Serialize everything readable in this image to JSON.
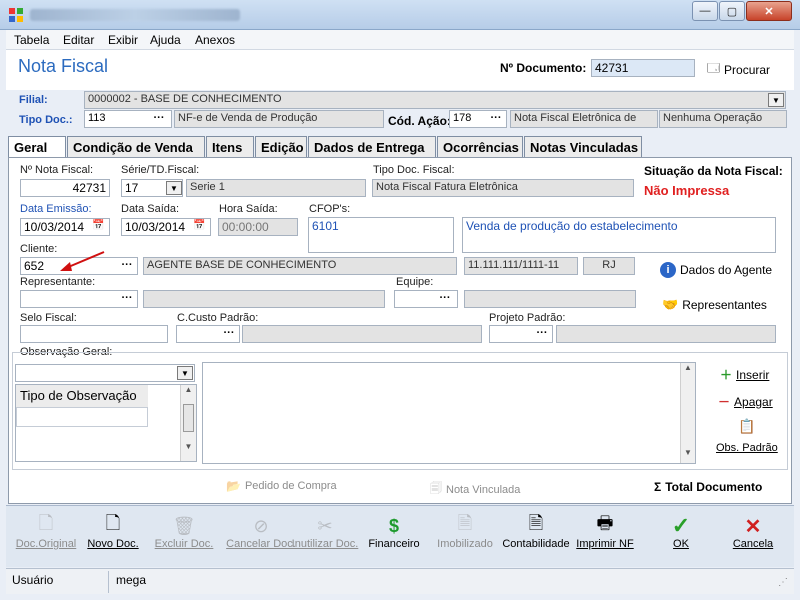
{
  "menu": [
    "Tabela",
    "Editar",
    "Exibir",
    "Ajuda",
    "Anexos"
  ],
  "header": {
    "title": "Nota Fiscal",
    "doc_label": "Nº Documento:",
    "doc_value": "42731",
    "search_label": "Procurar"
  },
  "filial": {
    "label": "Filial:",
    "value": "0000002 - BASE DE CONHECIMENTO"
  },
  "tipo_doc": {
    "label": "Tipo Doc.:",
    "code": "113",
    "desc": "NF-e de Venda de Produção"
  },
  "cod_acao": {
    "label": "Cód. Ação:",
    "code": "178",
    "desc": "Nota Fiscal Eletrônica de",
    "extra": "Nenhuma Operação"
  },
  "tabs": [
    "Geral",
    "Condição de Venda",
    "Itens",
    "Edição",
    "Dados de Entrega",
    "Ocorrências",
    "Notas Vinculadas"
  ],
  "geral": {
    "nf_label": "Nº Nota Fiscal:",
    "nf_value": "42731",
    "serie_label": "Série/TD.Fiscal:",
    "serie_value": "17",
    "serie_desc": "Serie 1",
    "tipo_doc_fiscal_label": "Tipo Doc. Fiscal:",
    "tipo_doc_fiscal_value": "Nota Fiscal Fatura Eletrônica",
    "situacao_label": "Situação da Nota Fiscal:",
    "situacao_value": "Não Impressa",
    "emissao_label": "Data Emissão:",
    "emissao_value": "10/03/2014",
    "saida_label": "Data Saída:",
    "saida_value": "10/03/2014",
    "hora_label": "Hora Saída:",
    "hora_value": "00:00:00",
    "cfop_label": "CFOP's:",
    "cfop_value": "6101",
    "cfop_desc": "Venda de produção do estabelecimento",
    "cliente_label": "Cliente:",
    "cliente_code": "652",
    "cliente_name": "AGENTE BASE DE CONHECIMENTO",
    "cliente_cnpj": "11.111.111/1111-11",
    "cliente_uf": "RJ",
    "dados_agente": "Dados do Agente",
    "representante_label": "Representante:",
    "equipe_label": "Equipe:",
    "representantes_btn": "Representantes",
    "selo_label": "Selo Fiscal:",
    "ccusto_label": "C.Custo Padrão:",
    "projeto_label": "Projeto Padrão:",
    "obs_label": "Observação Geral:",
    "obs_tipo_header": "Tipo de Observação",
    "inserir": "Inserir",
    "apagar": "Apagar",
    "obs_padrao": "Obs. Padrão",
    "pedido_compra": "Pedido de Compra",
    "nota_vinculada": "Nota Vinculada",
    "total_documento": "Total Documento"
  },
  "toolbar": [
    {
      "label": "Doc.Original",
      "icon": "document-icon",
      "enabled": false
    },
    {
      "label": "Novo Doc.",
      "icon": "new-doc-icon",
      "enabled": true
    },
    {
      "label": "Excluir Doc.",
      "icon": "delete-doc-icon",
      "enabled": false
    },
    {
      "label": "Cancelar Doc.",
      "icon": "cancel-icon",
      "enabled": false
    },
    {
      "label": "Inutilizar Doc.",
      "icon": "disable-icon",
      "enabled": false
    },
    {
      "label": "Financeiro",
      "icon": "dollar-icon",
      "enabled": true
    },
    {
      "label": "Imobilizado",
      "icon": "asset-icon",
      "enabled": false
    },
    {
      "label": "Contabilidade",
      "icon": "ledger-icon",
      "enabled": true
    },
    {
      "label": "Imprimir NF",
      "icon": "printer-icon",
      "enabled": true
    },
    {
      "label": "OK",
      "icon": "check-icon",
      "enabled": true
    },
    {
      "label": "Cancela",
      "icon": "x-icon",
      "enabled": true
    }
  ],
  "status": {
    "user_label": "Usuário",
    "user_value": "mega"
  },
  "colors": {
    "title_blue": "#2c6bbf",
    "status_red": "#e02020",
    "label_blue": "#1f52b5"
  }
}
